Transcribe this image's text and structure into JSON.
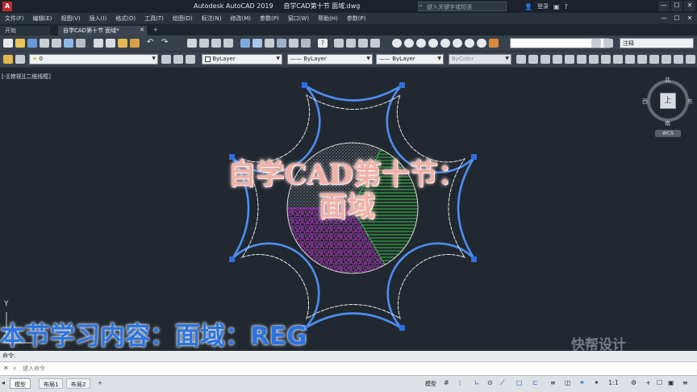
{
  "title": {
    "app": "Autodesk AutoCAD 2019",
    "file": "自学CAD第十节 面域.dwg",
    "search_placeholder": "键入关键字或短语",
    "user": "登录",
    "win_min": "—",
    "win_max": "☐",
    "win_close": "✕"
  },
  "menu": [
    "文件(F)",
    "编辑(E)",
    "视图(V)",
    "插入(I)",
    "格式(O)",
    "工具(T)",
    "绘图(D)",
    "标注(N)",
    "修改(M)",
    "参数(P)",
    "窗口(W)",
    "帮助(H)",
    "参数(P)"
  ],
  "tabs": {
    "start": "开始",
    "file": "自学CAD第十节 面域*",
    "add": "+"
  },
  "toolbar2": {
    "layer": "0",
    "color": "ByLayer",
    "linetype": "ByLayer",
    "lineweight": "ByLayer",
    "plotstyle": "ByColor",
    "right_combo": "注释"
  },
  "drawing": {
    "viewport_label": "[-][俯视][二维线框]",
    "viewcube": {
      "north": "北",
      "south": "南",
      "west": "西",
      "east": "东",
      "face": "上",
      "wcs": "WCS"
    },
    "ucs_y": "Y"
  },
  "overlay": {
    "title_line1": "自学CAD第十节：",
    "title_line2": "面域",
    "subtitle": "本节学习内容：面域：REG",
    "watermark": "快帮设计"
  },
  "colors": {
    "outline_blue": "#4d8ef0",
    "inner_white": "#e6e6e6",
    "hatch_green": "#36c33a",
    "hatch_purple": "#c13ad0",
    "grip": "#2f6fe0"
  },
  "command": {
    "history": "命令:",
    "placeholder": "键入命令",
    "close": "✕"
  },
  "status": {
    "model_tab": "模型",
    "layout1": "布局1",
    "layout2": "布局2",
    "add": "+",
    "model_label": "模型",
    "scale": "1:1"
  }
}
